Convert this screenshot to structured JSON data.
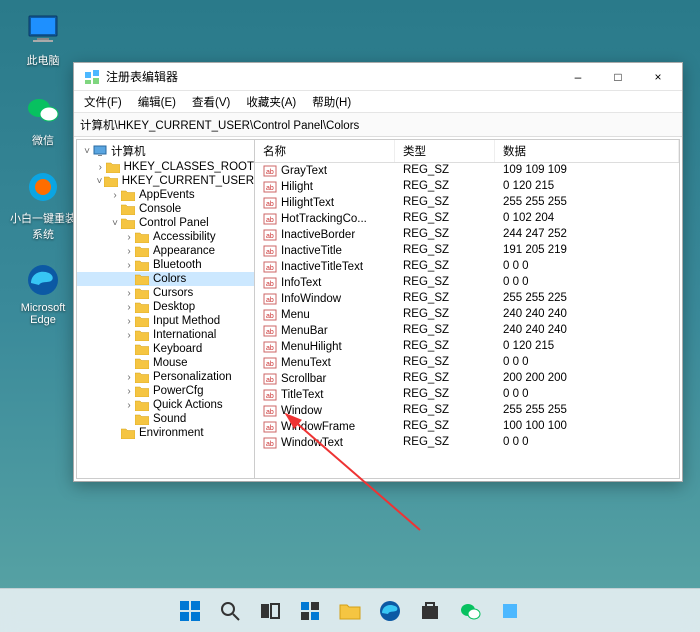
{
  "desktop": {
    "icons": [
      {
        "id": "this-pc",
        "label": "此电脑"
      },
      {
        "id": "wechat",
        "label": "微信"
      },
      {
        "id": "installer",
        "label": "小白一键重装\n系统"
      },
      {
        "id": "edge",
        "label": "Microsoft\nEdge"
      }
    ]
  },
  "window": {
    "title": "注册表编辑器",
    "min": "–",
    "max": "□",
    "close": "×",
    "menu": [
      "文件(F)",
      "编辑(E)",
      "查看(V)",
      "收藏夹(A)",
      "帮助(H)"
    ],
    "address": "计算机\\HKEY_CURRENT_USER\\Control Panel\\Colors",
    "tree": [
      {
        "d": 0,
        "exp": "v",
        "icon": "pc",
        "label": "计算机"
      },
      {
        "d": 1,
        "exp": ">",
        "icon": "f",
        "label": "HKEY_CLASSES_ROOT"
      },
      {
        "d": 1,
        "exp": "v",
        "icon": "f",
        "label": "HKEY_CURRENT_USER"
      },
      {
        "d": 2,
        "exp": ">",
        "icon": "f",
        "label": "AppEvents"
      },
      {
        "d": 2,
        "exp": "",
        "icon": "f",
        "label": "Console"
      },
      {
        "d": 2,
        "exp": "v",
        "icon": "f",
        "label": "Control Panel"
      },
      {
        "d": 3,
        "exp": ">",
        "icon": "f",
        "label": "Accessibility"
      },
      {
        "d": 3,
        "exp": ">",
        "icon": "f",
        "label": "Appearance"
      },
      {
        "d": 3,
        "exp": ">",
        "icon": "f",
        "label": "Bluetooth"
      },
      {
        "d": 3,
        "exp": "",
        "icon": "f",
        "label": "Colors",
        "sel": true
      },
      {
        "d": 3,
        "exp": ">",
        "icon": "f",
        "label": "Cursors"
      },
      {
        "d": 3,
        "exp": ">",
        "icon": "f",
        "label": "Desktop"
      },
      {
        "d": 3,
        "exp": ">",
        "icon": "f",
        "label": "Input Method"
      },
      {
        "d": 3,
        "exp": ">",
        "icon": "f",
        "label": "International"
      },
      {
        "d": 3,
        "exp": "",
        "icon": "f",
        "label": "Keyboard"
      },
      {
        "d": 3,
        "exp": "",
        "icon": "f",
        "label": "Mouse"
      },
      {
        "d": 3,
        "exp": ">",
        "icon": "f",
        "label": "Personalization"
      },
      {
        "d": 3,
        "exp": ">",
        "icon": "f",
        "label": "PowerCfg"
      },
      {
        "d": 3,
        "exp": ">",
        "icon": "f",
        "label": "Quick Actions"
      },
      {
        "d": 3,
        "exp": "",
        "icon": "f",
        "label": "Sound"
      },
      {
        "d": 2,
        "exp": "",
        "icon": "f",
        "label": "Environment"
      }
    ],
    "columns": {
      "name": "名称",
      "type": "类型",
      "data": "数据"
    },
    "values": [
      {
        "n": "GrayText",
        "t": "REG_SZ",
        "d": "109 109 109"
      },
      {
        "n": "Hilight",
        "t": "REG_SZ",
        "d": "0 120 215"
      },
      {
        "n": "HilightText",
        "t": "REG_SZ",
        "d": "255 255 255"
      },
      {
        "n": "HotTrackingCo...",
        "t": "REG_SZ",
        "d": "0 102 204"
      },
      {
        "n": "InactiveBorder",
        "t": "REG_SZ",
        "d": "244 247 252"
      },
      {
        "n": "InactiveTitle",
        "t": "REG_SZ",
        "d": "191 205 219"
      },
      {
        "n": "InactiveTitleText",
        "t": "REG_SZ",
        "d": "0 0 0"
      },
      {
        "n": "InfoText",
        "t": "REG_SZ",
        "d": "0 0 0"
      },
      {
        "n": "InfoWindow",
        "t": "REG_SZ",
        "d": "255 255 225"
      },
      {
        "n": "Menu",
        "t": "REG_SZ",
        "d": "240 240 240"
      },
      {
        "n": "MenuBar",
        "t": "REG_SZ",
        "d": "240 240 240"
      },
      {
        "n": "MenuHilight",
        "t": "REG_SZ",
        "d": "0 120 215"
      },
      {
        "n": "MenuText",
        "t": "REG_SZ",
        "d": "0 0 0"
      },
      {
        "n": "Scrollbar",
        "t": "REG_SZ",
        "d": "200 200 200"
      },
      {
        "n": "TitleText",
        "t": "REG_SZ",
        "d": "0 0 0"
      },
      {
        "n": "Window",
        "t": "REG_SZ",
        "d": "255 255 255"
      },
      {
        "n": "WindowFrame",
        "t": "REG_SZ",
        "d": "100 100 100"
      },
      {
        "n": "WindowText",
        "t": "REG_SZ",
        "d": "0 0 0"
      }
    ]
  },
  "taskbar": {
    "items": [
      "start",
      "search",
      "taskview",
      "widgets",
      "explorer",
      "edge",
      "store",
      "wechat",
      "app"
    ]
  }
}
